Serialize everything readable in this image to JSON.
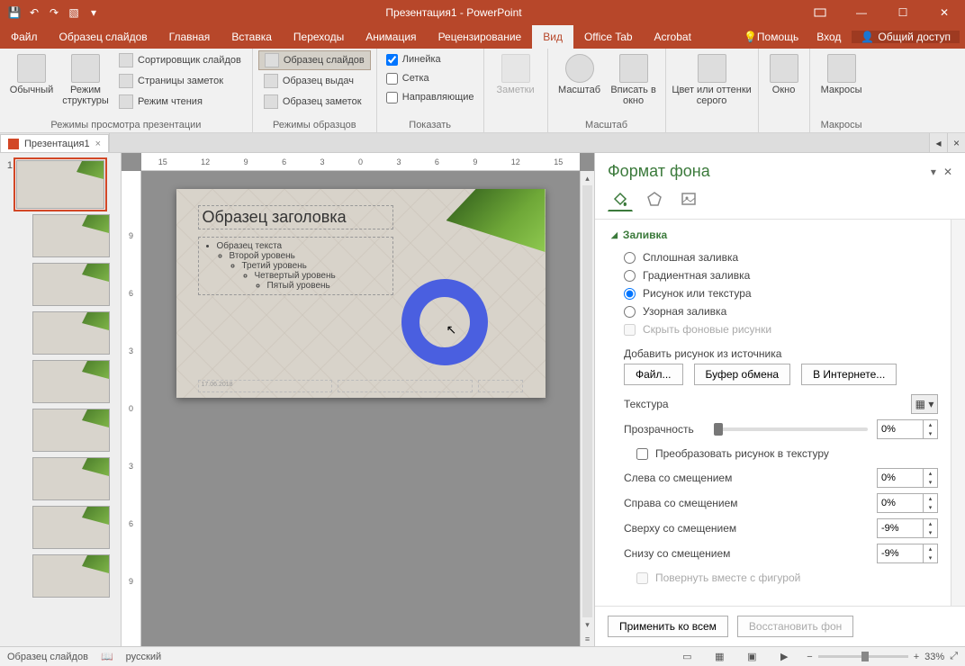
{
  "titlebar": {
    "title": "Презентация1 - PowerPoint"
  },
  "tabs": {
    "file": "Файл",
    "master": "Образец слайдов",
    "home": "Главная",
    "insert": "Вставка",
    "transitions": "Переходы",
    "animations": "Анимация",
    "review": "Рецензирование",
    "view": "Вид",
    "officetab": "Office Tab",
    "acrobat": "Acrobat",
    "help": "Помощь",
    "signin": "Вход",
    "share": "Общий доступ"
  },
  "ribbon": {
    "normal": "Обычный",
    "outline": "Режим структуры",
    "sorter": "Сортировщик слайдов",
    "notes_page": "Страницы заметок",
    "reading": "Режим чтения",
    "group_views": "Режимы просмотра презентации",
    "slide_master": "Образец слайдов",
    "handout_master": "Образец выдач",
    "notes_master": "Образец заметок",
    "group_masters": "Режимы образцов",
    "ruler": "Линейка",
    "grid": "Сетка",
    "guides": "Направляющие",
    "group_show": "Показать",
    "notes": "Заметки",
    "zoom": "Масштаб",
    "fit": "Вписать в окно",
    "group_zoom": "Масштаб",
    "color": "Цвет или оттенки серого",
    "window": "Окно",
    "macros": "Макросы",
    "group_macros": "Макросы"
  },
  "doctab": {
    "name": "Презентация1"
  },
  "ruler_h": [
    "15",
    "12",
    "9",
    "6",
    "3",
    "0",
    "3",
    "6",
    "9",
    "12",
    "15"
  ],
  "ruler_v": [
    "9",
    "6",
    "3",
    "0",
    "3",
    "6",
    "9"
  ],
  "slide": {
    "title": "Образец заголовка",
    "l1": "Образец текста",
    "l2": "Второй уровень",
    "l3": "Третий уровень",
    "l4": "Четвертый уровень",
    "l5": "Пятый уровень",
    "date": "17.06.2018"
  },
  "pane": {
    "title": "Формат фона",
    "section_fill": "Заливка",
    "solid": "Сплошная заливка",
    "gradient": "Градиентная заливка",
    "picture": "Рисунок или текстура",
    "pattern": "Узорная заливка",
    "hide_bg": "Скрыть фоновые рисунки",
    "insert_from": "Добавить рисунок из источника",
    "file_btn": "Файл...",
    "clipboard_btn": "Буфер обмена",
    "online_btn": "В Интернете...",
    "texture": "Текстура",
    "transparency": "Прозрачность",
    "transparency_val": "0%",
    "tile": "Преобразовать рисунок в текстуру",
    "off_left": "Слева со смещением",
    "off_left_v": "0%",
    "off_right": "Справа со смещением",
    "off_right_v": "0%",
    "off_top": "Сверху со смещением",
    "off_top_v": "-9%",
    "off_bottom": "Снизу со смещением",
    "off_bottom_v": "-9%",
    "rotate": "Повернуть вместе с фигурой",
    "apply_all": "Применить ко всем",
    "reset": "Восстановить фон"
  },
  "status": {
    "master": "Образец слайдов",
    "lang": "русский",
    "zoom": "33%"
  }
}
